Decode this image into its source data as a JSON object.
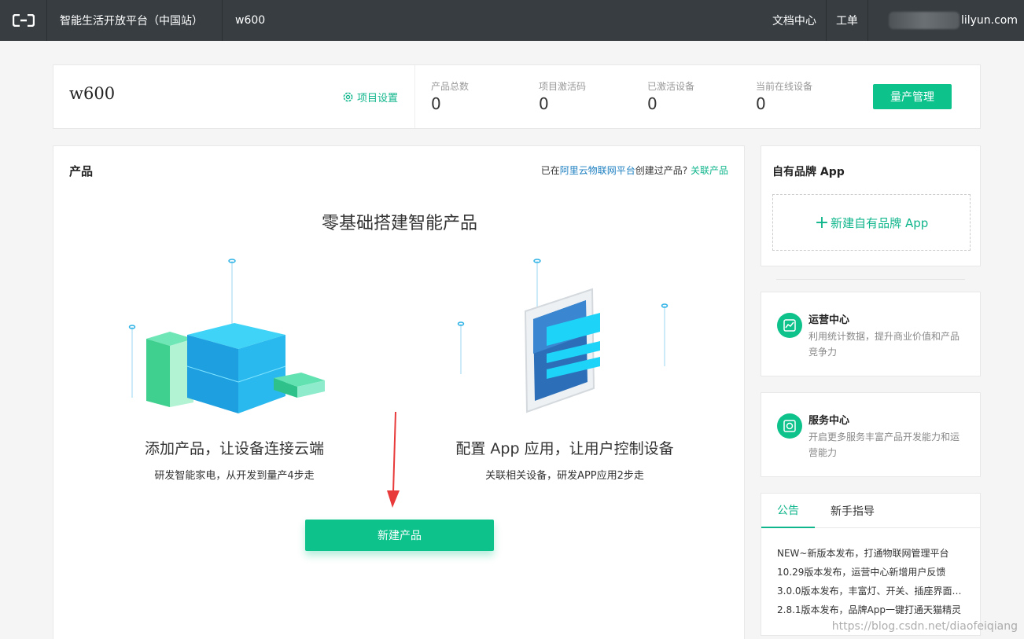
{
  "topbar": {
    "title": "智能生活开放平台（中国站）",
    "project": "w600",
    "docs": "文档中心",
    "ticket": "工单",
    "user_suffix": "lilyun.com"
  },
  "project": {
    "name": "w600",
    "settings": "项目设置",
    "stats": [
      {
        "label": "产品总数",
        "value": "0"
      },
      {
        "label": "项目激活码",
        "value": "0"
      },
      {
        "label": "已激活设备",
        "value": "0"
      },
      {
        "label": "当前在线设备",
        "value": "0"
      }
    ],
    "mass_button": "量产管理"
  },
  "products": {
    "title": "产品",
    "link_prefix": "已在",
    "link_platform": "阿里云物联网平台",
    "link_middle": "创建过产品?",
    "link_action": "关联产品",
    "heading": "零基础搭建智能产品",
    "features": [
      {
        "title": "添加产品，让设备连接云端",
        "subtitle": "研发智能家电，从开发到量产4步走"
      },
      {
        "title": "配置 App 应用，让用户控制设备",
        "subtitle": "关联相关设备，研发APP应用2步走"
      }
    ],
    "new_button": "新建产品"
  },
  "brand_app": {
    "title": "自有品牌 App",
    "new_label": "新建自有品牌 App"
  },
  "centers": [
    {
      "title": "运营中心",
      "desc": "利用统计数据，提升商业价值和产品竞争力",
      "icon": "chart-icon"
    },
    {
      "title": "服务中心",
      "desc": "开启更多服务丰富产品开发能力和运营能力",
      "icon": "service-icon"
    }
  ],
  "news": {
    "tabs": [
      "公告",
      "新手指导"
    ],
    "items": [
      "NEW~新版本发布，打通物联网管理平台",
      "10.29版本发布，运营中心新增用户反馈",
      "3.0.0版本发布，丰富灯、开关、插座界面…",
      "2.8.1版本发布，品牌App一键打通天猫精灵"
    ]
  },
  "watermark": "https://blog.csdn.net/diaofeiqiang",
  "colors": {
    "accent": "#0ec28c",
    "topbar": "#373d41",
    "link": "#1c7fc1"
  }
}
